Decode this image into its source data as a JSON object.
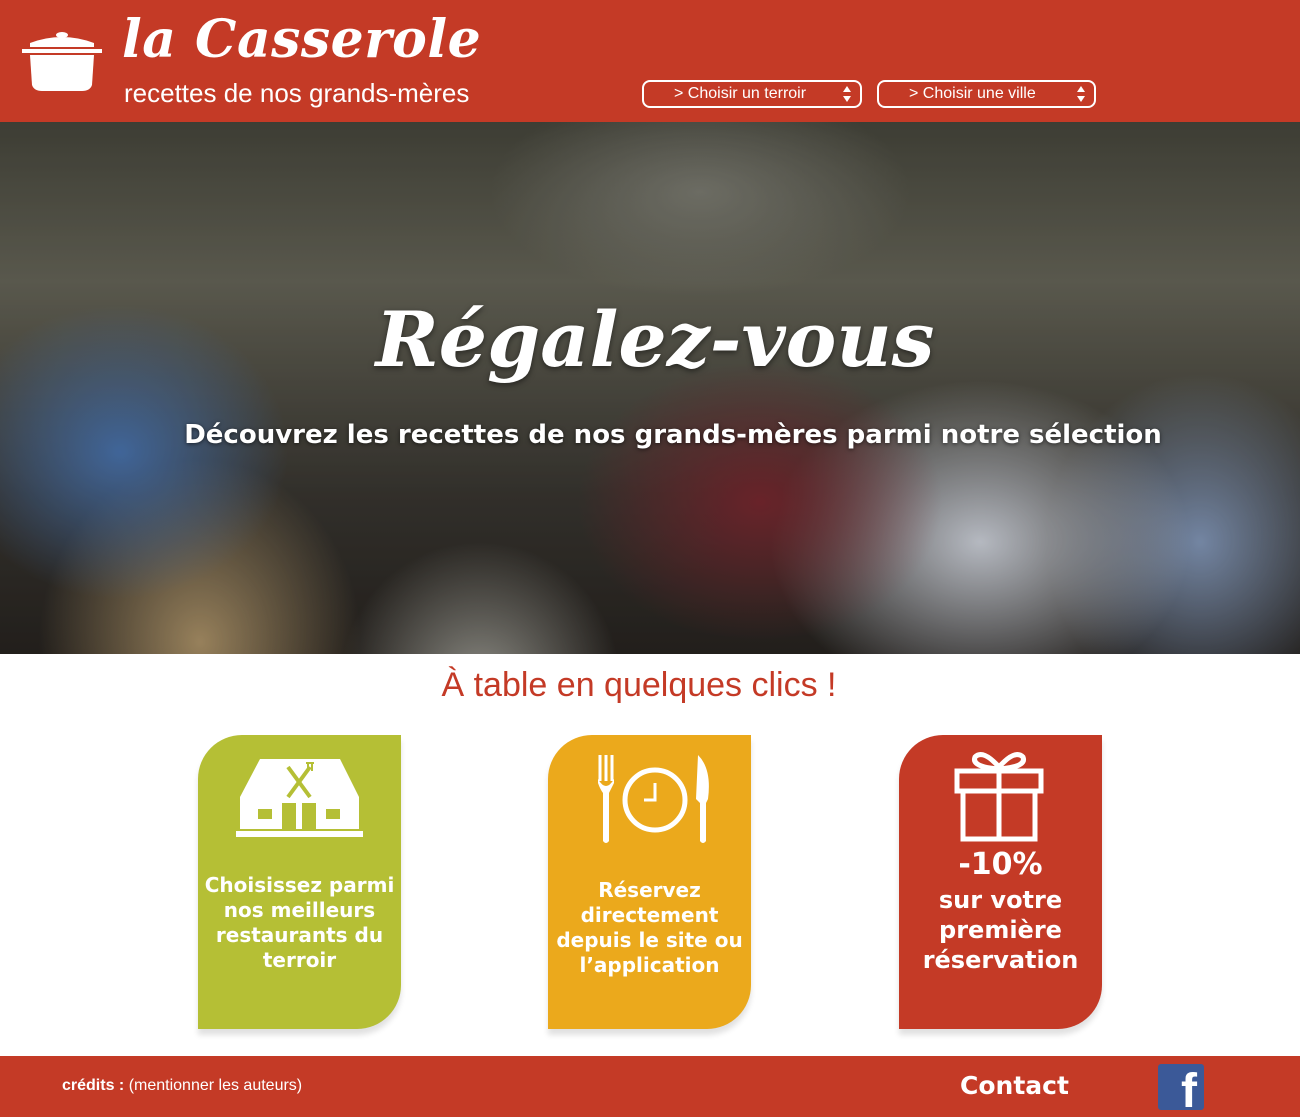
{
  "header": {
    "brand_title": "la Casserole",
    "tagline": "recettes de nos grands-mères",
    "select_terroir": "> Choisir un terroir",
    "select_ville": "> Choisir une ville"
  },
  "hero": {
    "title": "Régalez-vous",
    "subtitle": "Découvrez les recettes de nos grands-mères parmi notre sélection"
  },
  "section": {
    "title": "À table en quelques clics !"
  },
  "cards": [
    {
      "icon": "restaurant-icon",
      "text": "Choisissez parmi nos meilleurs restaurants du terroir"
    },
    {
      "icon": "fork-clock-knife-icon",
      "text": "Réservez directement depuis le site ou l’application"
    },
    {
      "icon": "gift-icon",
      "highlight": "-10%",
      "text": "sur votre première réservation"
    }
  ],
  "footer": {
    "credits_label": "crédits :",
    "credits_text": "(mentionner les auteurs)",
    "contact": "Contact",
    "facebook_glyph": "f"
  },
  "colors": {
    "brand_red": "#c43a26",
    "card_green": "#b5bf35",
    "card_orange": "#eba91c",
    "facebook_blue": "#3b5998"
  }
}
